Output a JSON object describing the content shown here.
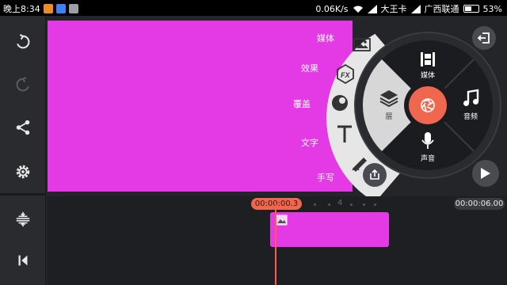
{
  "status_bar": {
    "time": "晚上8:34",
    "speed": "0.06K/s",
    "carrier1": "大王卡",
    "carrier2": "广西联通",
    "battery": "53%",
    "battery_level": 0.53
  },
  "left_toolbar": {
    "items": [
      {
        "name": "undo-icon"
      },
      {
        "name": "redo-icon"
      },
      {
        "name": "share-icon"
      },
      {
        "name": "settings-icon"
      },
      {
        "name": "timeline-expand-icon"
      },
      {
        "name": "skip-to-start-icon"
      }
    ]
  },
  "fan_menu": {
    "media": "媒体",
    "effects": "效果",
    "overlay": "覆盖",
    "text": "文字",
    "handwriting": "手写"
  },
  "wheel_menu": {
    "media": "媒体",
    "audio": "音频",
    "voice": "声音",
    "layer": "层"
  },
  "timeline": {
    "current_time": "00:00:00.3",
    "total_time": "00:00:06.00",
    "ruler_mark": "4"
  },
  "colors": {
    "accent": "#f0674f",
    "clip": "#e43ae6"
  }
}
